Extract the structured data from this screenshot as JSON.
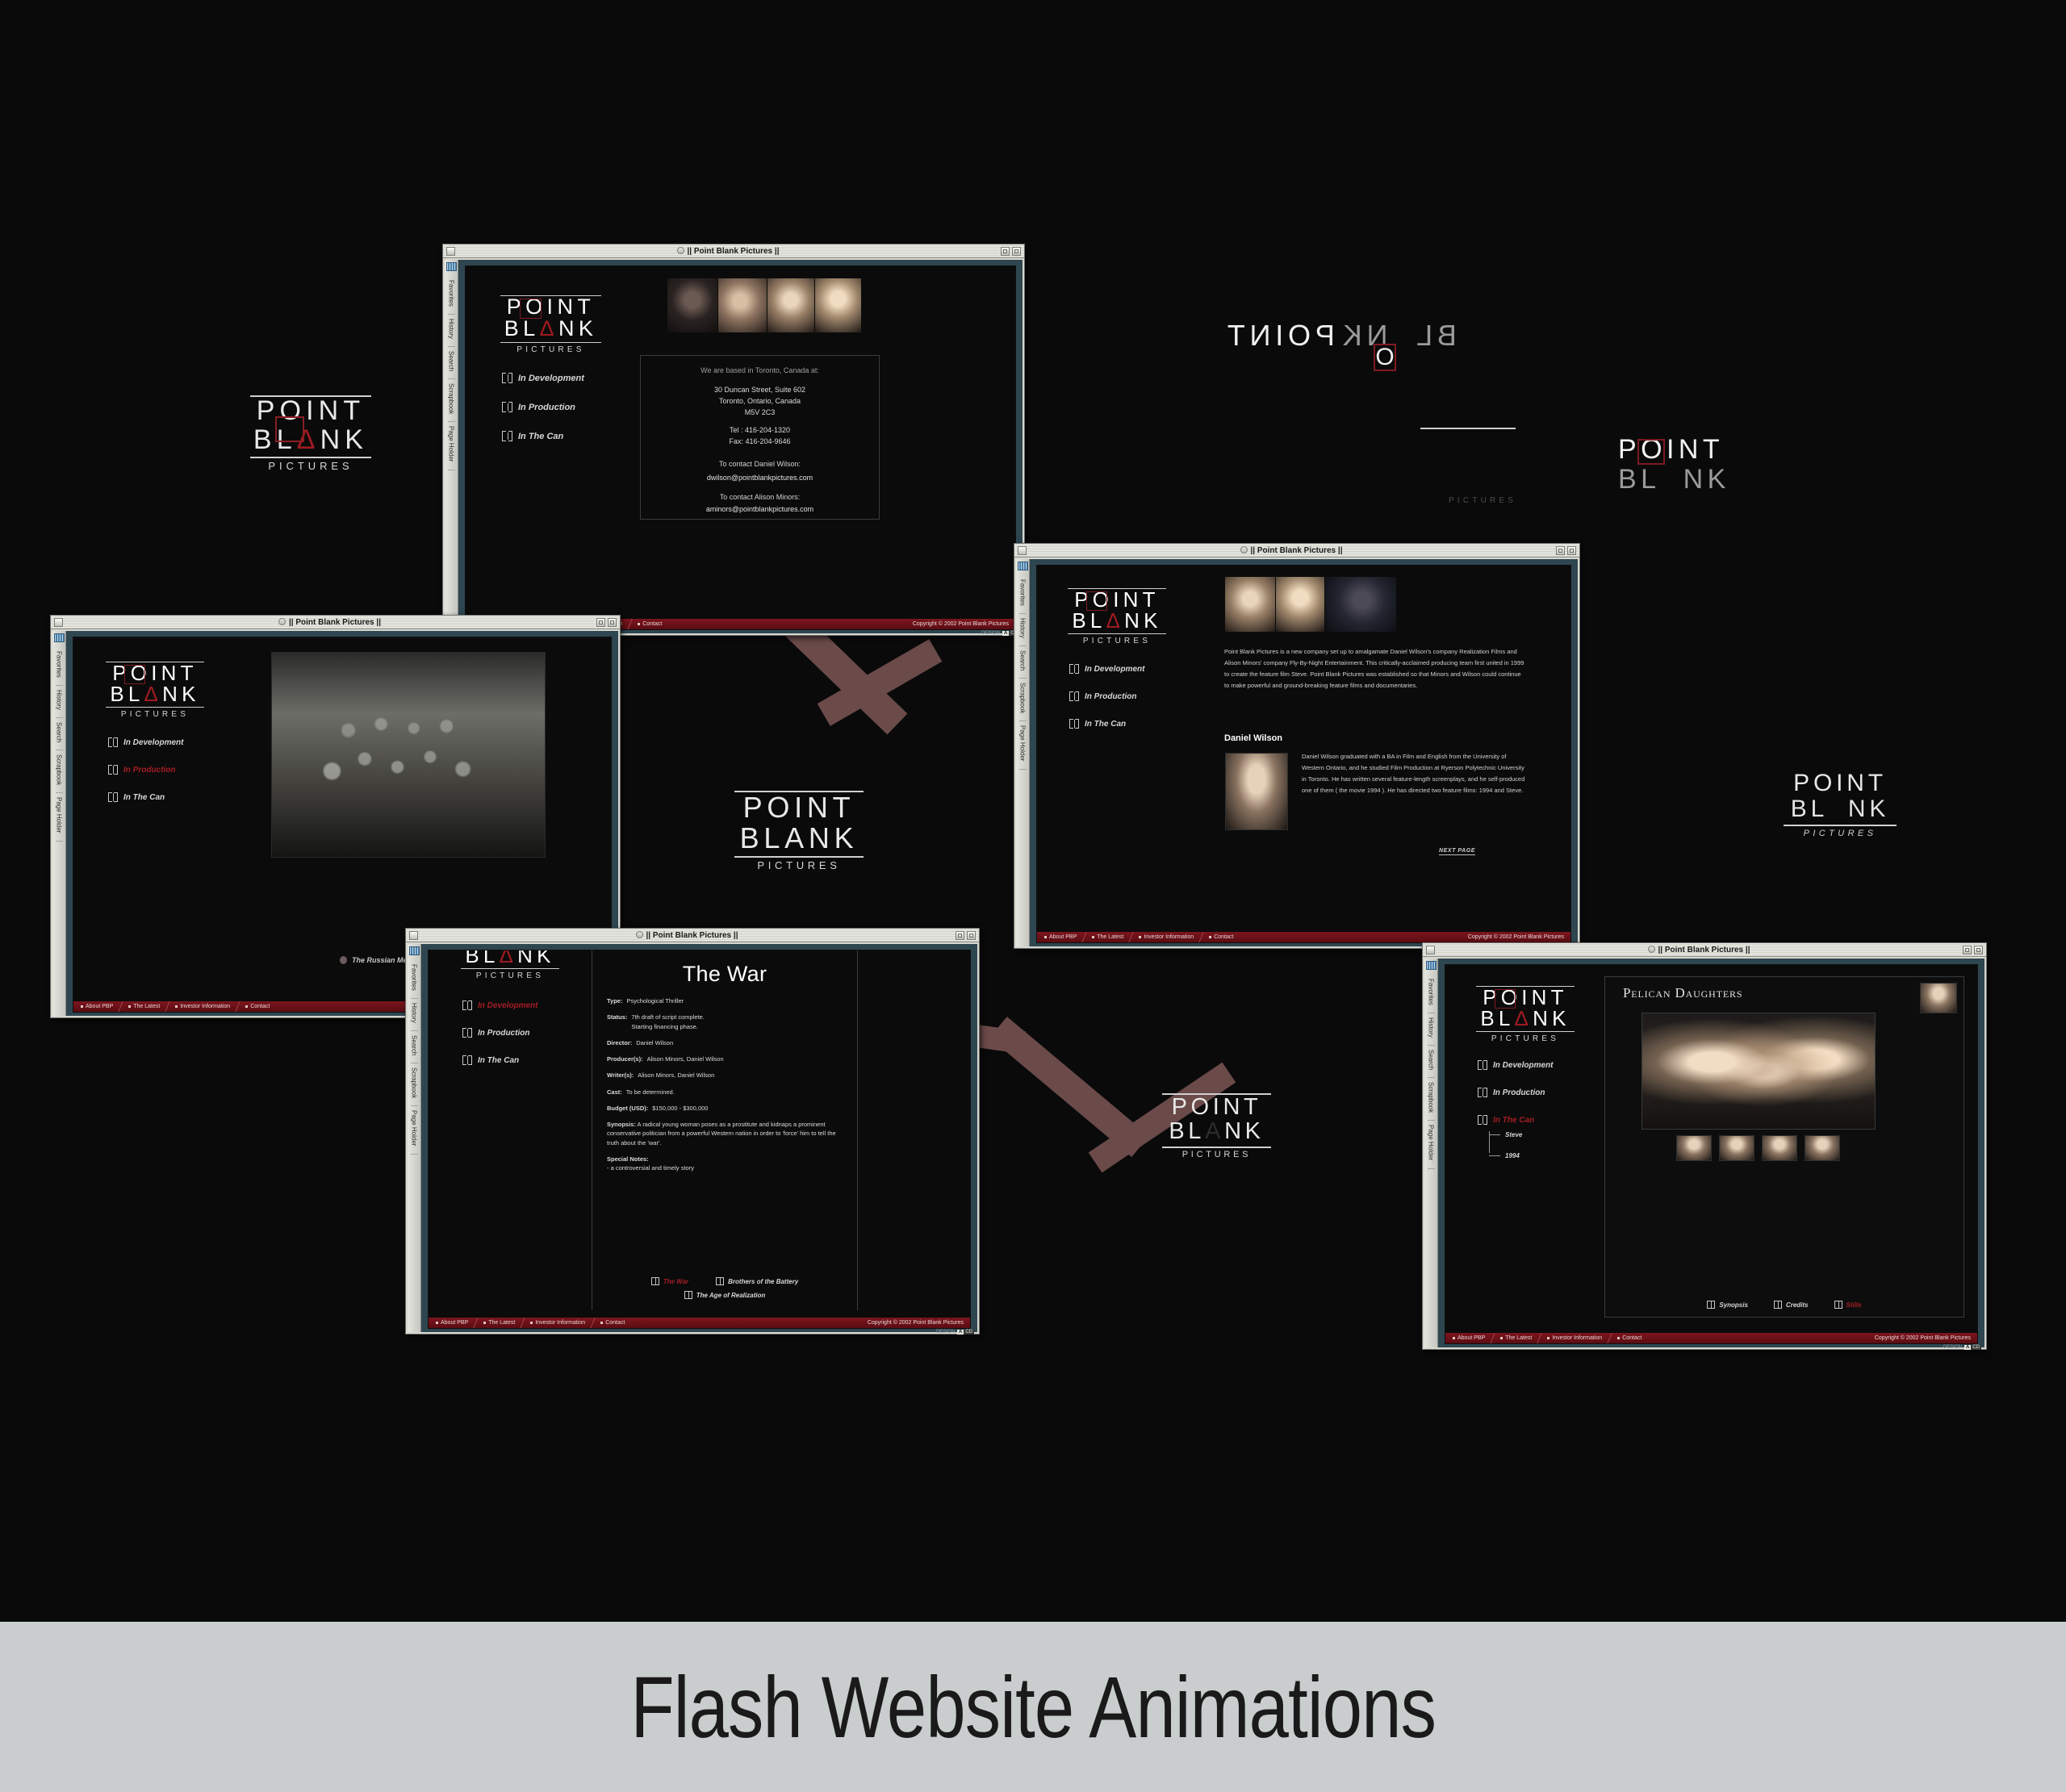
{
  "caption": "Flash Website Animations",
  "brand": {
    "line1": "POINT",
    "line2_a": "BL",
    "line2_v": "Ʌ",
    "line2_b": "NK",
    "line3": "PICTURES",
    "accent_red": "#9e1b22",
    "target_red": "#7d1a22"
  },
  "window_title": "|| Point Blank Pictures ||",
  "browser_tabs": [
    "Favorites",
    "History",
    "Search",
    "Scrapbook",
    "Page Holder"
  ],
  "footer": {
    "items": [
      "About PBP",
      "The Latest",
      "Investor Information",
      "Contact"
    ],
    "copyright": "Copyright © 2002  Point Blank Pictures",
    "design_label": "DESIGN",
    "design_chip_a": "A",
    "design_chip_b": "CD"
  },
  "main_nav": [
    {
      "label": "In Development",
      "selected": false
    },
    {
      "label": "In Production",
      "selected": false
    },
    {
      "label": "In The Can",
      "selected": false
    }
  ],
  "contact_window": {
    "intro": "We are based in Toronto, Canada at:",
    "address_line1": "30 Duncan Street, Suite 602",
    "address_line2": "Toronto, Ontario, Canada",
    "address_line3": "M5V 2C3",
    "tel": "Tel : 416-204-1320",
    "fax": "Fax: 416-204-9646",
    "contact1_label": "To contact Daniel Wilson:",
    "contact1_email": "dwilson@pointblankpictures.com",
    "contact2_label": "To contact Alison Minors:",
    "contact2_email": "aminors@pointblankpictures.com"
  },
  "mennonite_window": {
    "caption": "The Russian Mennonite Exodus",
    "nav": [
      {
        "label": "In Development",
        "selected": false
      },
      {
        "label": "In Production",
        "selected": true
      },
      {
        "label": "In The Can",
        "selected": false
      }
    ]
  },
  "about_window": {
    "paragraph": "Point Blank Pictures is a new company set up to amalgamate Daniel Wilson's company Realization Films and Alison Minors' company Fly-By-Night Entertainment. This critically-acclaimed producing team first united in 1999 to create the feature film Steve. Point Blank Pictures was established so that Minors and Wilson could continue to make powerful and ground-breaking feature films and documentaries.",
    "person_name": "Daniel Wilson",
    "person_bio": "Daniel Wilson graduated with a BA in Film and English from the University of Western Ontario, and he studied Film Production at Ryerson Polytechnic University in Toronto. He has written several feature-length screenplays, and he self-produced one of them ( the movie 1994 ). He has directed two feature films: 1994 and Steve.",
    "next_page": "NEXT PAGE"
  },
  "thewar_window": {
    "title": "The War",
    "fields": [
      {
        "label": "Type:",
        "value": "Psychological Thriller"
      },
      {
        "label": "Status:",
        "value": "7th draft of script complete.\nStarting financing phase."
      },
      {
        "label": "Director:",
        "value": "Daniel Wilson"
      },
      {
        "label": "Producer(s):",
        "value": "Alison Minors, Daniel Wilson"
      },
      {
        "label": "Writer(s):",
        "value": "Alison Minors, Daniel Wilson"
      },
      {
        "label": "Cast:",
        "value": "To be determined."
      },
      {
        "label": "Budget (USD):",
        "value": "$150,000 - $300,000"
      },
      {
        "label": "Synopsis:",
        "value": "A radical young woman poses as a prostitute and kidnaps a prominent conservative politician from a powerful Western nation in order to 'force' him to tell the truth about the 'war'."
      },
      {
        "label": "Special Notes:",
        "value": "- a controversial and timely story"
      }
    ],
    "film_links": [
      {
        "label": "The War",
        "selected": true
      },
      {
        "label": "Brothers of the Battery",
        "selected": false
      },
      {
        "label": "The Age of Realization",
        "selected": false
      }
    ],
    "sidebar_nav": [
      {
        "label": "In Development",
        "selected": true
      },
      {
        "label": "In Production",
        "selected": false
      },
      {
        "label": "In The Can",
        "selected": false
      }
    ]
  },
  "pelican_window": {
    "title": "Pelican Daughters",
    "nav": [
      {
        "label": "In Development",
        "selected": false
      },
      {
        "label": "In Production",
        "selected": false
      },
      {
        "label": "In The Can",
        "selected": true
      }
    ],
    "sub_nav": [
      "Steve",
      "1994"
    ],
    "tabs": [
      {
        "label": "Synopsis",
        "selected": false
      },
      {
        "label": "Credits",
        "selected": false
      },
      {
        "label": "Stills",
        "selected": true
      }
    ]
  },
  "animation_art": {
    "flipped_point": "POINT",
    "flipped_blank_a": "BL",
    "flipped_blank_b": "NK",
    "o_glyph": "O",
    "pictures_ghost": "PICTURES",
    "right_point": "POINT",
    "right_blank_a": "BL",
    "right_blank_b": "NK",
    "left_point": "POINT",
    "left_blank": "BLANK",
    "left_pictures": "PICTURES",
    "mid_point": "POINT",
    "mid_blank": "BLANK",
    "mid_pictures": "PICTURES",
    "low_point": "POINT",
    "low_blank_a": "BL",
    "low_blank_b": "NK",
    "low_pictures": "PICTURES",
    "right_lower_point": "POINT",
    "right_lower_blank_a": "BL",
    "right_lower_blank_b": "NK",
    "right_lower_pictures": "PICTURES"
  }
}
